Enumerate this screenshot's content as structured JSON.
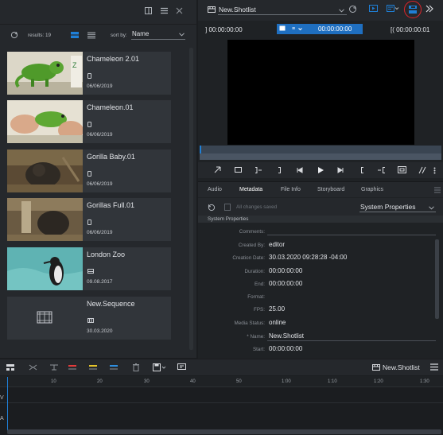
{
  "browser": {
    "results_label": "results: 19",
    "sort_label": "sort by:",
    "sort_value": "Name",
    "items": [
      {
        "title": "Chameleon 2.01",
        "date": "06/06/2019",
        "type_icon": "phone-icon",
        "thumb": "chameleon"
      },
      {
        "title": "Chameleon.01",
        "date": "06/06/2019",
        "type_icon": "phone-icon",
        "thumb": "chameleon-hands"
      },
      {
        "title": "Gorilla Baby.01",
        "date": "06/06/2019",
        "type_icon": "phone-icon",
        "thumb": "gorilla"
      },
      {
        "title": "Gorillas Full.01",
        "date": "06/06/2019",
        "type_icon": "phone-icon",
        "thumb": "gorillas"
      },
      {
        "title": "London Zoo",
        "date": "09.08.2017",
        "type_icon": "video-icon",
        "thumb": "penguin"
      },
      {
        "title": "New.Sequence",
        "date": "30.03.2020",
        "type_icon": "sequence-icon",
        "thumb": "sequence"
      }
    ]
  },
  "viewer": {
    "title": "New.Shotlist",
    "tc_in": "] 00:00:00:00",
    "tc_current": "00:00:00:00",
    "tc_mode": "≡",
    "tc_out": "[( 00:00:00:01"
  },
  "tabs": [
    {
      "label": "Audio",
      "active": false
    },
    {
      "label": "Metadata",
      "active": true
    },
    {
      "label": "File Info",
      "active": false
    },
    {
      "label": "Storyboard",
      "active": false
    },
    {
      "label": "Graphics",
      "active": false
    }
  ],
  "metadata": {
    "status": "All changes saved",
    "preset": "System Properties",
    "section": "System Properties",
    "fields": [
      {
        "label": "Comments:",
        "value": ""
      },
      {
        "label": "Created By:",
        "value": "editor"
      },
      {
        "label": "Creation Date:",
        "value": "30.03.2020 09:28:28 -04:00"
      },
      {
        "label": "Duration:",
        "value": "00:00:00:00"
      },
      {
        "label": "End:",
        "value": "00:00:00:00"
      },
      {
        "label": "Format:",
        "value": ""
      },
      {
        "label": "FPS:",
        "value": "25.00"
      },
      {
        "label": "Media Status:",
        "value": "online"
      },
      {
        "label": "* Name:",
        "value": "New.Shotlist"
      },
      {
        "label": "Start:",
        "value": "00:00:00:00"
      }
    ]
  },
  "timeline": {
    "title": "New.Shotlist",
    "ticks": [
      "10",
      "20",
      "30",
      "40",
      "50",
      "1:00",
      "1:10",
      "1:20",
      "1:30"
    ],
    "track_v": "V",
    "track_a": "A"
  },
  "colors": {
    "accent": "#1f7fd6",
    "highlight_circle": "#e0242a",
    "panel": "#25282c",
    "card": "#31353a"
  }
}
